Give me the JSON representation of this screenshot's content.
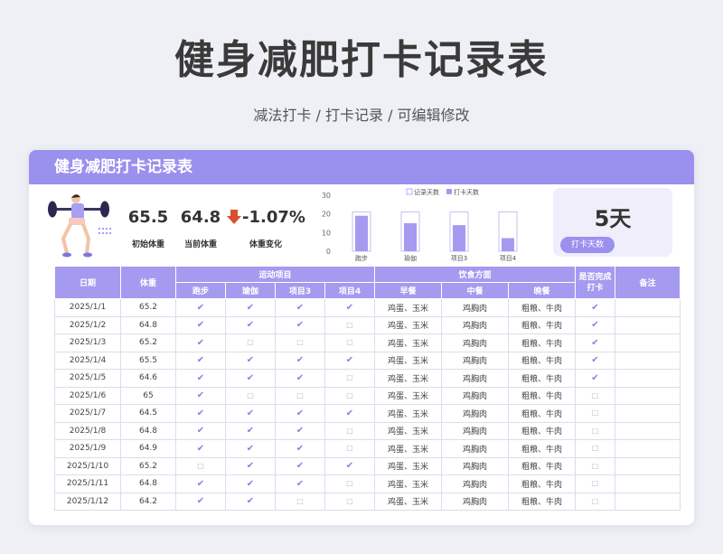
{
  "page": {
    "title": "健身减肥打卡记录表",
    "subtitle": "减法打卡 / 打卡记录 / 可编辑修改"
  },
  "card": {
    "header": "健身减肥打卡记录表"
  },
  "summary": {
    "initial_weight": "65.5",
    "initial_weight_label": "初始体重",
    "current_weight": "64.8",
    "current_weight_label": "当前体重",
    "change": "-1.07%",
    "change_label": "体重变化",
    "days_value": "5天",
    "days_button": "打卡天数"
  },
  "chart_data": {
    "type": "bar",
    "categories": [
      "跑步",
      "瑜伽",
      "项目3",
      "项目4"
    ],
    "series": [
      {
        "name": "记录天数",
        "values": [
          21,
          21,
          21,
          21
        ]
      },
      {
        "name": "打卡天数",
        "values": [
          19,
          15,
          14,
          7
        ]
      }
    ],
    "ylim": [
      0,
      30
    ],
    "yticks": [
      "0",
      "10",
      "20",
      "30"
    ],
    "legend_position": "top"
  },
  "table": {
    "headers": {
      "date": "日期",
      "weight": "体重",
      "exercise_group": "运动项目",
      "diet_group": "饮食方面",
      "done": "是否完成打卡",
      "note": "备注",
      "exercise_cols": [
        "跑步",
        "瑜伽",
        "项目3",
        "项目4"
      ],
      "diet_cols": [
        "早餐",
        "中餐",
        "晚餐"
      ]
    },
    "rows": [
      {
        "date": "2025/1/1",
        "weight": "65.2",
        "ex": [
          1,
          1,
          1,
          1
        ],
        "b": "鸡蛋、玉米",
        "l": "鸡胸肉",
        "d": "粗粮、牛肉",
        "done": 1
      },
      {
        "date": "2025/1/2",
        "weight": "64.8",
        "ex": [
          1,
          1,
          1,
          0
        ],
        "b": "鸡蛋、玉米",
        "l": "鸡胸肉",
        "d": "粗粮、牛肉",
        "done": 1
      },
      {
        "date": "2025/1/3",
        "weight": "65.2",
        "ex": [
          1,
          0,
          0,
          0
        ],
        "b": "鸡蛋、玉米",
        "l": "鸡胸肉",
        "d": "粗粮、牛肉",
        "done": 1
      },
      {
        "date": "2025/1/4",
        "weight": "65.5",
        "ex": [
          1,
          1,
          1,
          1
        ],
        "b": "鸡蛋、玉米",
        "l": "鸡胸肉",
        "d": "粗粮、牛肉",
        "done": 1
      },
      {
        "date": "2025/1/5",
        "weight": "64.6",
        "ex": [
          1,
          1,
          1,
          0
        ],
        "b": "鸡蛋、玉米",
        "l": "鸡胸肉",
        "d": "粗粮、牛肉",
        "done": 1
      },
      {
        "date": "2025/1/6",
        "weight": "65",
        "ex": [
          1,
          0,
          0,
          0
        ],
        "b": "鸡蛋、玉米",
        "l": "鸡胸肉",
        "d": "粗粮、牛肉",
        "done": 0
      },
      {
        "date": "2025/1/7",
        "weight": "64.5",
        "ex": [
          1,
          1,
          1,
          1
        ],
        "b": "鸡蛋、玉米",
        "l": "鸡胸肉",
        "d": "粗粮、牛肉",
        "done": 0
      },
      {
        "date": "2025/1/8",
        "weight": "64.8",
        "ex": [
          1,
          1,
          1,
          0
        ],
        "b": "鸡蛋、玉米",
        "l": "鸡胸肉",
        "d": "粗粮、牛肉",
        "done": 0
      },
      {
        "date": "2025/1/9",
        "weight": "64.9",
        "ex": [
          1,
          1,
          1,
          0
        ],
        "b": "鸡蛋、玉米",
        "l": "鸡胸肉",
        "d": "粗粮、牛肉",
        "done": 0
      },
      {
        "date": "2025/1/10",
        "weight": "65.2",
        "ex": [
          0,
          1,
          1,
          1
        ],
        "b": "鸡蛋、玉米",
        "l": "鸡胸肉",
        "d": "粗粮、牛肉",
        "done": 0
      },
      {
        "date": "2025/1/11",
        "weight": "64.8",
        "ex": [
          1,
          1,
          1,
          0
        ],
        "b": "鸡蛋、玉米",
        "l": "鸡胸肉",
        "d": "粗粮、牛肉",
        "done": 0
      },
      {
        "date": "2025/1/12",
        "weight": "64.2",
        "ex": [
          1,
          1,
          0,
          0
        ],
        "b": "鸡蛋、玉米",
        "l": "鸡胸肉",
        "d": "粗粮、牛肉",
        "done": 0
      }
    ]
  },
  "colors": {
    "accent": "#9a90ee",
    "bar_fill": "#a49bf0",
    "down_arrow": "#d9502f"
  },
  "icons": {
    "weightlifter": "weightlifter-illustration",
    "down_arrow": "arrow-down-icon",
    "check": "check-icon",
    "empty": "empty-box-icon"
  }
}
